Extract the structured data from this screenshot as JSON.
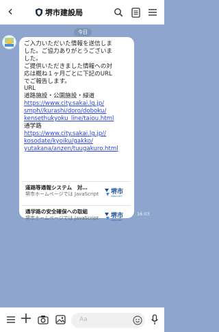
{
  "header": {
    "title": "堺市建設局"
  },
  "chat": {
    "date_chip": "今日",
    "message": {
      "line1": "ご入力いただいた情報を送信しま",
      "line2": "した。ご協力ありがとうございま",
      "line3": "した。",
      "line4": "ご提供いただきました情報への対",
      "line5": "応は概ね１ヶ月ごとに下記のURL",
      "line6": "でご報告します。",
      "line7": "URL",
      "line8": "道路施設・公園施設・緑道",
      "link1_l1": "https://www.city.sakai.lg.jp/",
      "link1_l2": "smph//kurashi/doro/doboku/",
      "link1_l3": "kensethukyoku_line/taiou.html",
      "line9": "通学路",
      "link2_l1": "https://www.city.sakai.lg.jp//",
      "link2_l2": "kosodate/kyoiku/gakko/",
      "link2_l3": "yutakana/anzen/tuugakuro.html"
    },
    "cards": [
      {
        "title": "道路等通報システム　対…",
        "desc": "堺市ホームページでは JavaScriptを使用していま…",
        "logo_text": "堺市",
        "logo_sub": "SAKAI CITY"
      },
      {
        "title": "通学路の安全確保への取組",
        "desc": "堺市ホームページでは JavaScriptを使用していま…",
        "logo_text": "堺市",
        "logo_sub": "SAKAI CITY"
      }
    ],
    "timestamp": "16:03"
  },
  "bottom_bar": {
    "input_placeholder": "Aa"
  },
  "icons": [
    "back-icon",
    "shield-icon",
    "search-icon",
    "notes-icon",
    "menu-icon",
    "menu-list-icon",
    "plus-icon",
    "camera-icon",
    "image-icon",
    "emoji-icon",
    "mic-icon"
  ],
  "colors": {
    "chat_bg": "#8ea6cd",
    "link": "#2a46d9",
    "date_chip": "#7f95b8",
    "city_logo_blue": "#1d4fa0"
  }
}
